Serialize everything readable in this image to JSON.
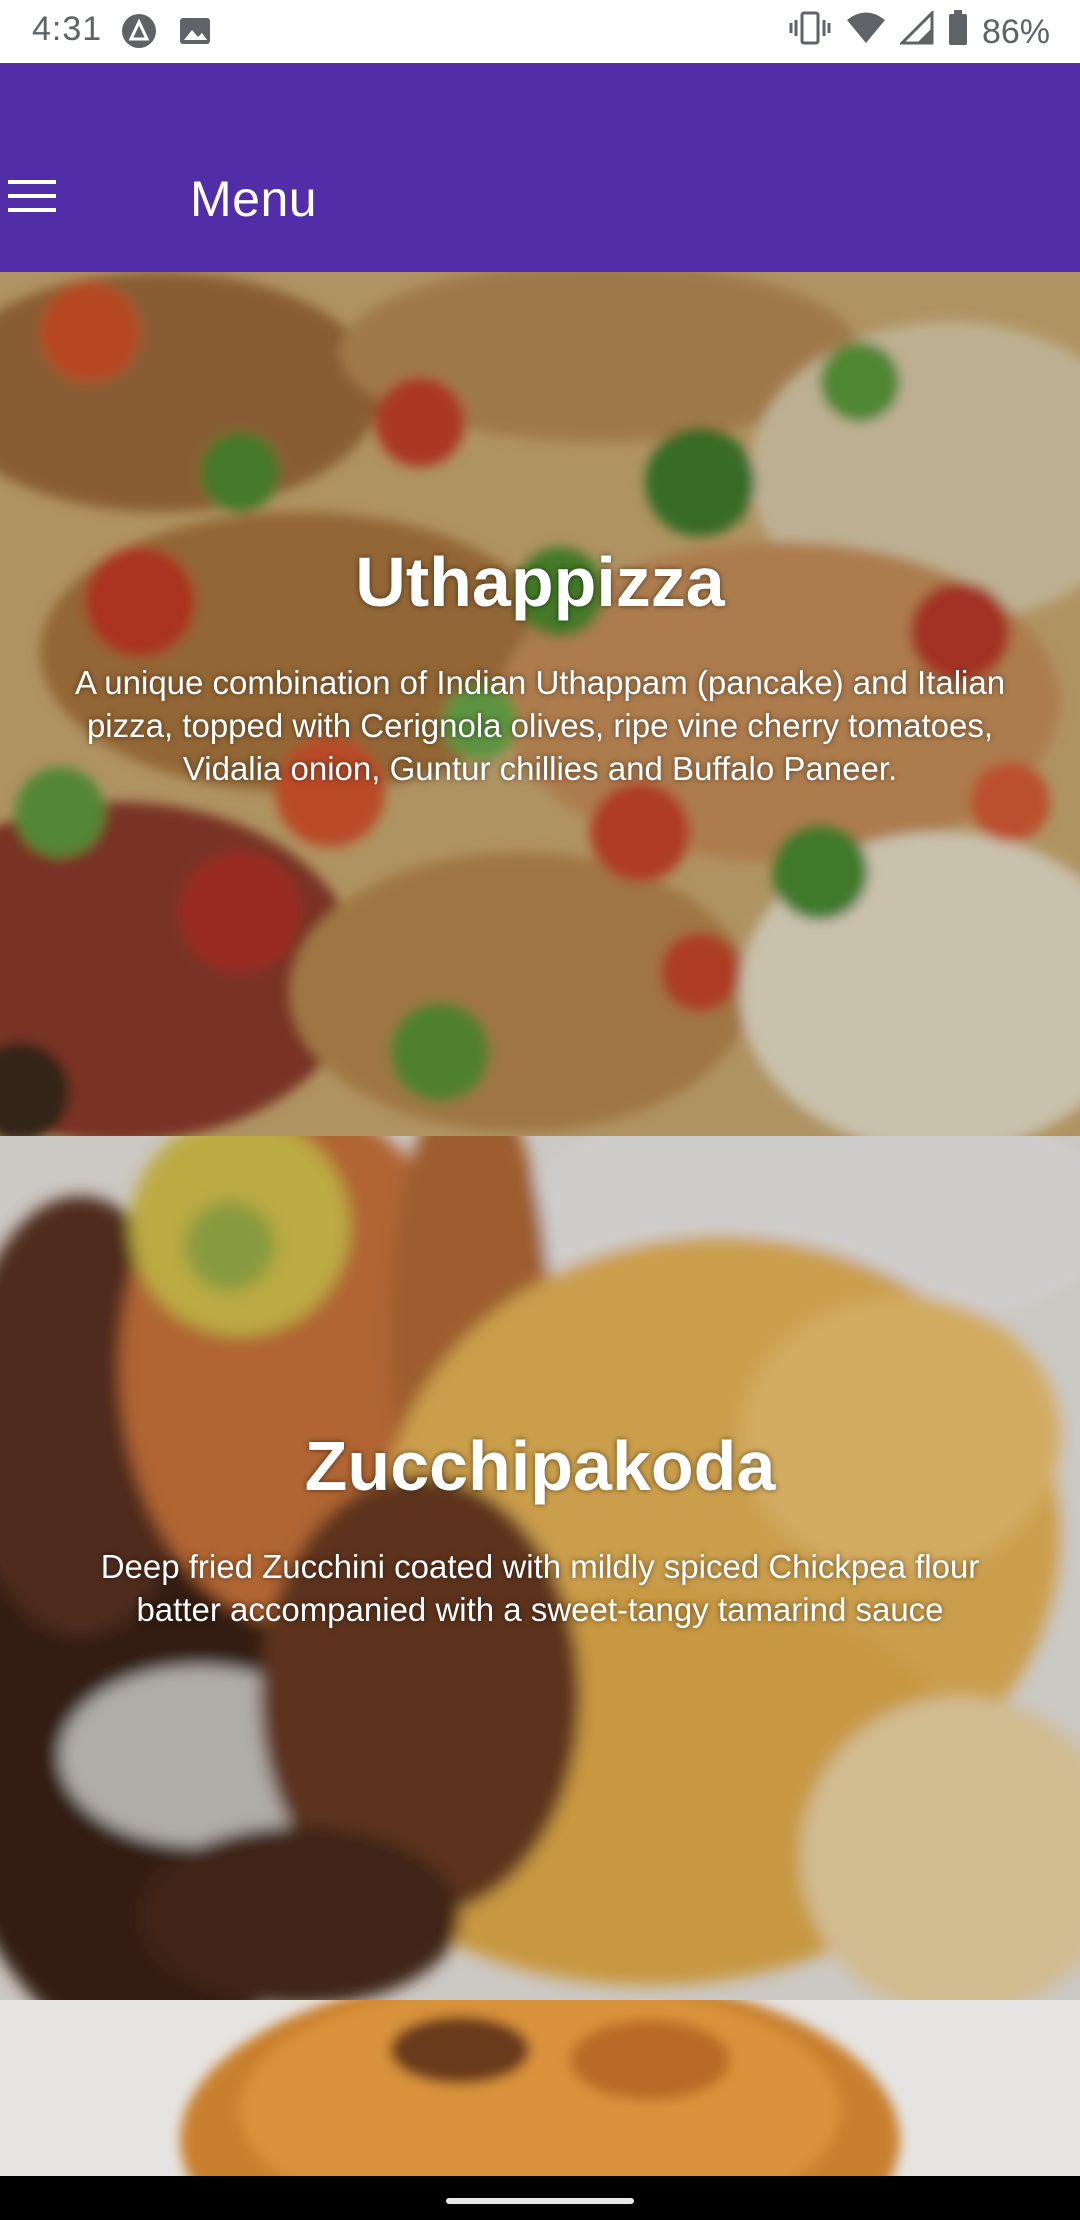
{
  "status_bar": {
    "time": "4:31",
    "battery": "86%",
    "icons": [
      "app-notification-icon",
      "image-icon",
      "vibrate-icon",
      "wifi-icon",
      "signal-icon",
      "battery-icon"
    ]
  },
  "app_bar": {
    "title": "Menu",
    "color": "#512da8"
  },
  "dishes": [
    {
      "name": "Uthappizza",
      "description": "A unique combination of Indian Uthappam (pancake) and Italian pizza, topped with Cerignola olives, ripe vine cherry tomatoes, Vidalia onion, Guntur chillies and Buffalo Paneer."
    },
    {
      "name": "Zucchipakoda",
      "description": "Deep fried Zucchini coated with mildly spiced Chickpea flour batter accompanied with a sweet-tangy tamarind sauce"
    },
    {
      "name": "",
      "description": ""
    }
  ]
}
